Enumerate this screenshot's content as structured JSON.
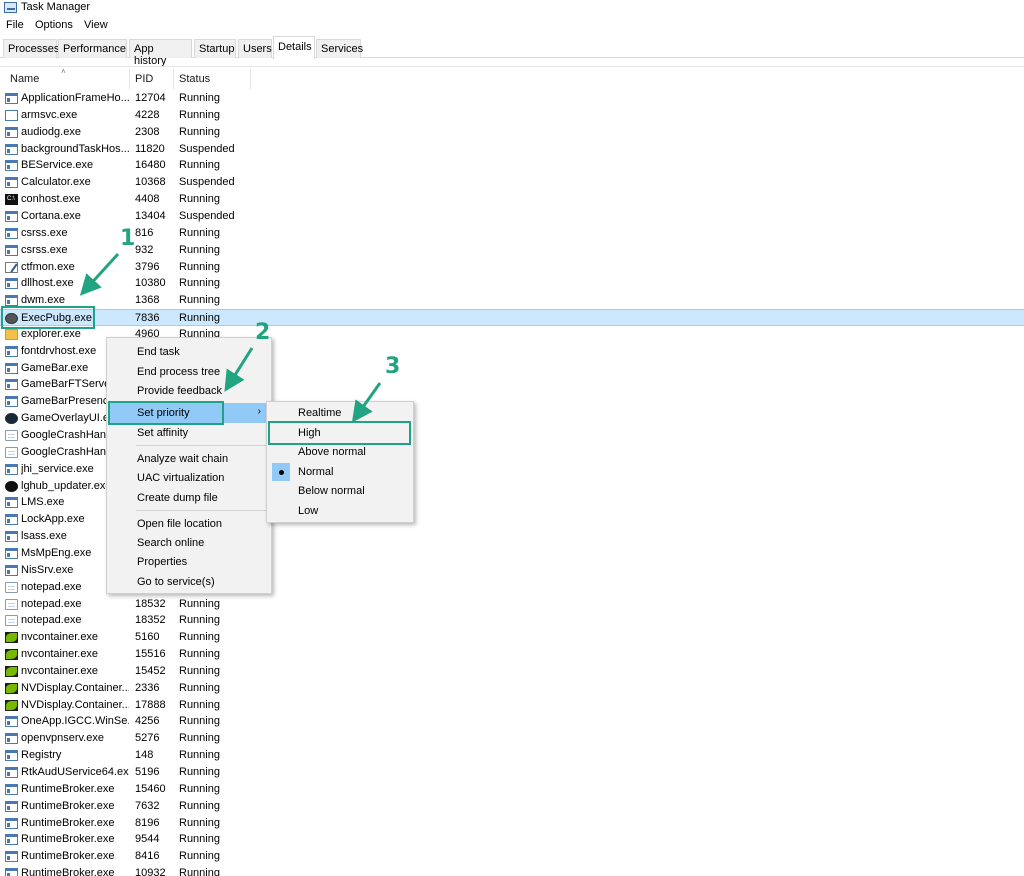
{
  "window": {
    "title": "Task Manager"
  },
  "menu": [
    "File",
    "Options",
    "View"
  ],
  "tabs": [
    {
      "label": "Processes"
    },
    {
      "label": "Performance"
    },
    {
      "label": "App history"
    },
    {
      "label": "Startup"
    },
    {
      "label": "Users"
    },
    {
      "label": "Details",
      "active": true
    },
    {
      "label": "Services"
    }
  ],
  "columns": {
    "name": "Name",
    "pid": "PID",
    "status": "Status"
  },
  "processes": [
    {
      "name": "ApplicationFrameHo...",
      "pid": "12704",
      "status": "Running",
      "icon": "app-icon"
    },
    {
      "name": "armsvc.exe",
      "pid": "4228",
      "status": "Running",
      "icon": "blank-window-icon"
    },
    {
      "name": "audiodg.exe",
      "pid": "2308",
      "status": "Running",
      "icon": "app-icon"
    },
    {
      "name": "backgroundTaskHos...",
      "pid": "11820",
      "status": "Suspended",
      "icon": "app-icon"
    },
    {
      "name": "BEService.exe",
      "pid": "16480",
      "status": "Running",
      "icon": "app-icon"
    },
    {
      "name": "Calculator.exe",
      "pid": "10368",
      "status": "Suspended",
      "icon": "app-icon"
    },
    {
      "name": "conhost.exe",
      "pid": "4408",
      "status": "Running",
      "icon": "console-icon"
    },
    {
      "name": "Cortana.exe",
      "pid": "13404",
      "status": "Suspended",
      "icon": "app-icon"
    },
    {
      "name": "csrss.exe",
      "pid": "816",
      "status": "Running",
      "icon": "app-icon"
    },
    {
      "name": "csrss.exe",
      "pid": "932",
      "status": "Running",
      "icon": "app-icon"
    },
    {
      "name": "ctfmon.exe",
      "pid": "3796",
      "status": "Running",
      "icon": "pen-icon"
    },
    {
      "name": "dllhost.exe",
      "pid": "10380",
      "status": "Running",
      "icon": "app-icon"
    },
    {
      "name": "dwm.exe",
      "pid": "1368",
      "status": "Running",
      "icon": "app-icon"
    },
    {
      "name": "ExecPubg.exe",
      "pid": "7836",
      "status": "Running",
      "icon": "pubg-icon",
      "selected": true
    },
    {
      "name": "explorer.exe",
      "pid": "4960",
      "status": "Running",
      "icon": "folder-icon"
    },
    {
      "name": "fontdrvhost.exe",
      "pid": "",
      "status": "",
      "icon": "app-icon"
    },
    {
      "name": "GameBar.exe",
      "pid": "",
      "status": "",
      "icon": "app-icon"
    },
    {
      "name": "GameBarFTServer.",
      "pid": "",
      "status": "",
      "icon": "app-icon"
    },
    {
      "name": "GameBarPresence",
      "pid": "",
      "status": "",
      "icon": "app-icon"
    },
    {
      "name": "GameOverlayUI.ex",
      "pid": "",
      "status": "",
      "icon": "steam-icon"
    },
    {
      "name": "GoogleCrashHanc",
      "pid": "",
      "status": "",
      "icon": "doc-icon"
    },
    {
      "name": "GoogleCrashHanc",
      "pid": "",
      "status": "",
      "icon": "doc-icon"
    },
    {
      "name": "jhi_service.exe",
      "pid": "",
      "status": "",
      "icon": "app-icon"
    },
    {
      "name": "lghub_updater.exe",
      "pid": "",
      "status": "",
      "icon": "logitech-icon"
    },
    {
      "name": "LMS.exe",
      "pid": "",
      "status": "",
      "icon": "app-icon"
    },
    {
      "name": "LockApp.exe",
      "pid": "",
      "status": "",
      "icon": "app-icon"
    },
    {
      "name": "lsass.exe",
      "pid": "",
      "status": "",
      "icon": "app-icon"
    },
    {
      "name": "MsMpEng.exe",
      "pid": "",
      "status": "",
      "icon": "app-icon"
    },
    {
      "name": "NisSrv.exe",
      "pid": "",
      "status": "",
      "icon": "app-icon"
    },
    {
      "name": "notepad.exe",
      "pid": "",
      "status": "",
      "icon": "doc-icon"
    },
    {
      "name": "notepad.exe",
      "pid": "18532",
      "status": "Running",
      "icon": "doc-icon"
    },
    {
      "name": "notepad.exe",
      "pid": "18352",
      "status": "Running",
      "icon": "doc-icon"
    },
    {
      "name": "nvcontainer.exe",
      "pid": "5160",
      "status": "Running",
      "icon": "nvidia-icon"
    },
    {
      "name": "nvcontainer.exe",
      "pid": "15516",
      "status": "Running",
      "icon": "nvidia-icon"
    },
    {
      "name": "nvcontainer.exe",
      "pid": "15452",
      "status": "Running",
      "icon": "nvidia-icon"
    },
    {
      "name": "NVDisplay.Container...",
      "pid": "2336",
      "status": "Running",
      "icon": "nvidia-icon"
    },
    {
      "name": "NVDisplay.Container...",
      "pid": "17888",
      "status": "Running",
      "icon": "nvidia-icon"
    },
    {
      "name": "OneApp.IGCC.WinSe...",
      "pid": "4256",
      "status": "Running",
      "icon": "app-icon"
    },
    {
      "name": "openvpnserv.exe",
      "pid": "5276",
      "status": "Running",
      "icon": "app-icon"
    },
    {
      "name": "Registry",
      "pid": "148",
      "status": "Running",
      "icon": "app-icon"
    },
    {
      "name": "RtkAudUService64.exe",
      "pid": "5196",
      "status": "Running",
      "icon": "app-icon"
    },
    {
      "name": "RuntimeBroker.exe",
      "pid": "15460",
      "status": "Running",
      "icon": "app-icon"
    },
    {
      "name": "RuntimeBroker.exe",
      "pid": "7632",
      "status": "Running",
      "icon": "app-icon"
    },
    {
      "name": "RuntimeBroker.exe",
      "pid": "8196",
      "status": "Running",
      "icon": "app-icon"
    },
    {
      "name": "RuntimeBroker.exe",
      "pid": "9544",
      "status": "Running",
      "icon": "app-icon"
    },
    {
      "name": "RuntimeBroker.exe",
      "pid": "8416",
      "status": "Running",
      "icon": "app-icon"
    },
    {
      "name": "RuntimeBroker.exe",
      "pid": "10932",
      "status": "Running",
      "icon": "app-icon"
    }
  ],
  "context_menu": {
    "items": [
      {
        "label": "End task"
      },
      {
        "label": "End process tree"
      },
      {
        "label": "Provide feedback"
      },
      {
        "label": "Set priority",
        "highlighted": true,
        "has_submenu": true
      },
      {
        "label": "Set affinity"
      },
      {
        "label": "Analyze wait chain"
      },
      {
        "label": "UAC virtualization"
      },
      {
        "label": "Create dump file"
      },
      {
        "label": "Open file location"
      },
      {
        "label": "Search online"
      },
      {
        "label": "Properties"
      },
      {
        "label": "Go to service(s)"
      }
    ]
  },
  "priority_submenu": {
    "items": [
      {
        "label": "Realtime"
      },
      {
        "label": "High",
        "highlighted": true
      },
      {
        "label": "Above normal"
      },
      {
        "label": "Normal",
        "checked": true
      },
      {
        "label": "Below normal"
      },
      {
        "label": "Low"
      }
    ]
  },
  "annotations": {
    "step1": "1",
    "step2": "2",
    "step3": "3",
    "color": "#1fa286"
  },
  "colors": {
    "selection_row": "#cce8ff",
    "menu_highlight": "#91c9f7",
    "annotation": "#22a381"
  }
}
